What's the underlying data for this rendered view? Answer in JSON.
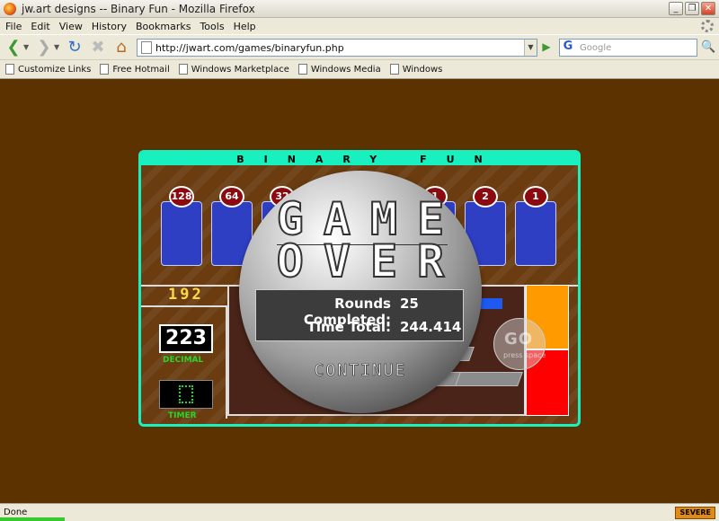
{
  "window": {
    "title": "jw.art designs -- Binary Fun - Mozilla Firefox",
    "controls": [
      "_",
      "❐",
      "✕"
    ]
  },
  "menu": [
    "File",
    "Edit",
    "View",
    "History",
    "Bookmarks",
    "Tools",
    "Help"
  ],
  "nav": {
    "url": "http://jwart.com/games/binaryfun.php",
    "search_placeholder": "Google",
    "search_engine_glyph": "G"
  },
  "bookmarks": [
    "Customize Links",
    "Free Hotmail",
    "Windows Marketplace",
    "Windows Media",
    "Windows"
  ],
  "game": {
    "title": "BINARY FUN",
    "bit_values": [
      "128",
      "64",
      "32",
      "1",
      "2",
      "1"
    ],
    "binary_display": "192",
    "decimal_value": "223",
    "decimal_label": "DECIMAL",
    "timer_label": "TIMER",
    "go_label": "GO",
    "go_hint": "press space",
    "game_over": {
      "line1": "GAME",
      "line2": "OVER",
      "rounds_label": "Rounds Completed:",
      "rounds_value": "25",
      "time_label": "Time Total:",
      "time_value": "244.414",
      "continue_label": "CONTINUE"
    }
  },
  "status": {
    "text": "Done",
    "badge": "SEVERE"
  },
  "colors": {
    "page_background": "#5c3300",
    "frame_accent": "#18f0c0",
    "card_blue": "#2f3fc4",
    "badge_red": "#8a0a10",
    "decimal_green": "#22d82a",
    "binary_yellow": "#ffd84a"
  }
}
